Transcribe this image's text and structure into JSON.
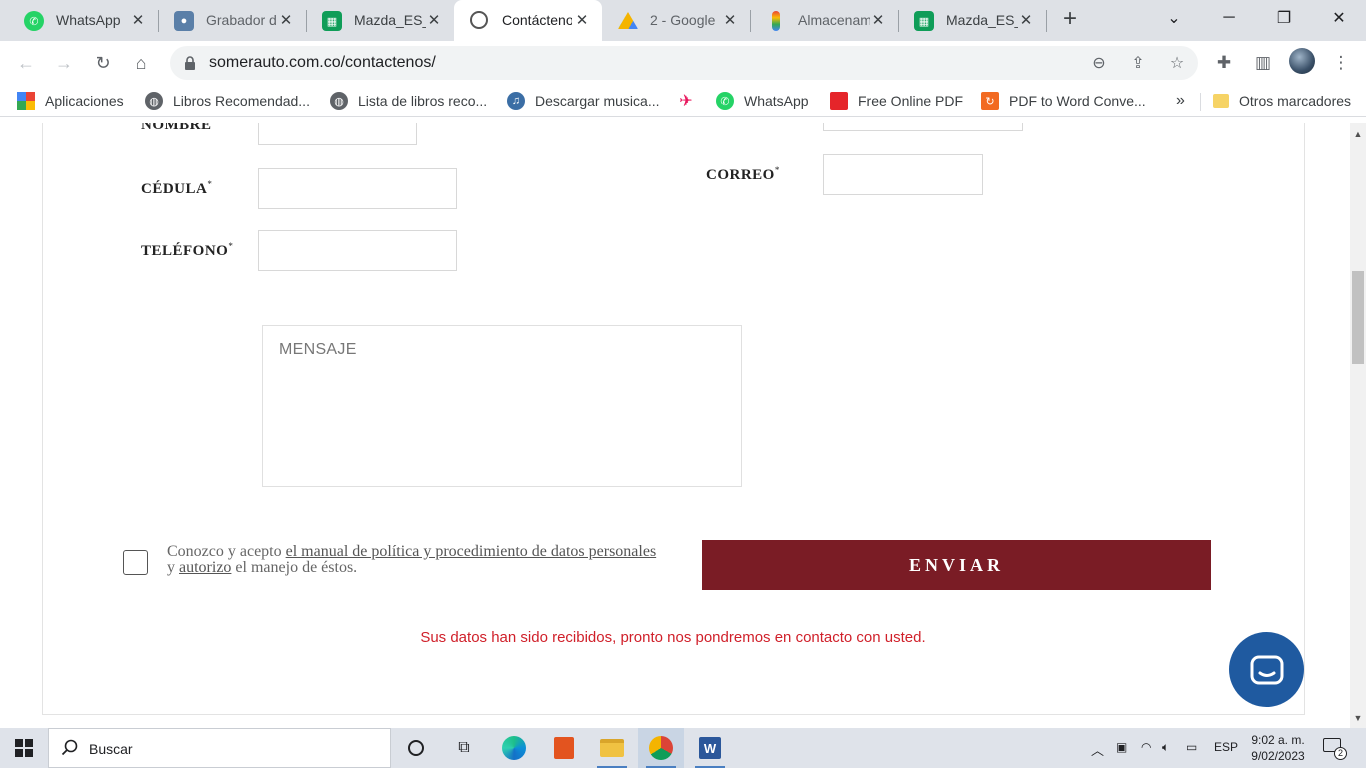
{
  "browser": {
    "tabs": [
      {
        "title": "WhatsApp",
        "icon": "whatsapp-icon"
      },
      {
        "title": "Grabador d",
        "icon": "recorder-icon"
      },
      {
        "title": "Mazda_ES_",
        "icon": "sheets-icon"
      },
      {
        "title": "Contáctenos",
        "icon": "site-icon"
      },
      {
        "title": "2 - Google",
        "icon": "drive-icon"
      },
      {
        "title": "Almacenam",
        "icon": "google-one-icon"
      },
      {
        "title": "Mazda_ES_",
        "icon": "sheets-icon"
      }
    ],
    "url": "somerauto.com.co/contactenos/",
    "bookmarks": [
      {
        "label": "Aplicaciones",
        "icon": "apps-grid-icon"
      },
      {
        "label": "Libros Recomendad...",
        "icon": "globe-icon"
      },
      {
        "label": "Lista de libros reco...",
        "icon": "globe-icon"
      },
      {
        "label": "Descargar musica...",
        "icon": "music-icon"
      },
      {
        "label": "",
        "icon": "send-icon"
      },
      {
        "label": "WhatsApp",
        "icon": "whatsapp-icon"
      },
      {
        "label": "Free Online PDF",
        "icon": "pdf-icon"
      },
      {
        "label": "PDF to Word Conve...",
        "icon": "pdf-word-icon"
      }
    ],
    "overflow": "»",
    "other_bookmarks": "Otros marcadores"
  },
  "form": {
    "nombre_label": "NOMBRE",
    "cedula_label": "CÉDULA",
    "telefono_label": "TELÉFONO",
    "correo_label": "CORREO",
    "required_mark": "*",
    "mensaje_placeholder": "MENSAJE",
    "consent_prefix": "Conozco y acepto ",
    "consent_link1": "el manual de política y procedimiento de datos personales",
    "consent_mid": " y ",
    "consent_link2": "autorizo",
    "consent_suffix": " el manejo de éstos.",
    "submit_label": "ENVIAR",
    "success_message": "Sus datos han sido recibidos, pronto nos pondremos en contacto con usted."
  },
  "taskbar": {
    "search_placeholder": "Buscar",
    "language": "ESP",
    "time": "9:02 a. m.",
    "date": "9/02/2023",
    "notification_count": "2"
  }
}
